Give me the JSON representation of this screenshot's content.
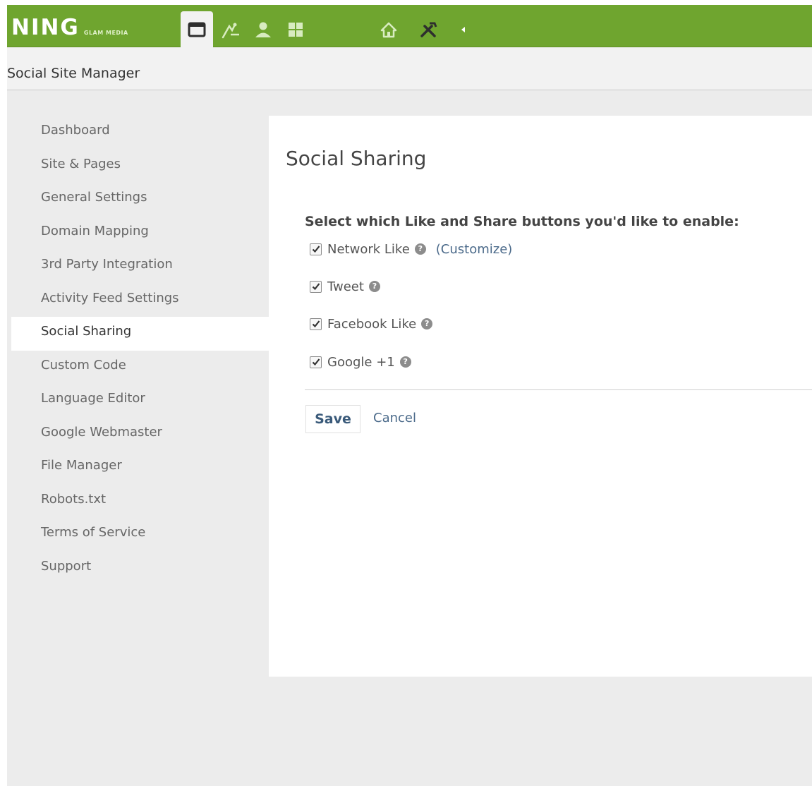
{
  "brand": {
    "logo": "NING",
    "logo_sub": "GLAM MEDIA"
  },
  "colors": {
    "topbar": "#6fa52f",
    "link": "#4b6a8a"
  },
  "topnav": {
    "icons": [
      "window-icon",
      "paint-icon",
      "person-icon",
      "grid-icon",
      "home-icon",
      "tools-icon",
      "caret-left-icon"
    ],
    "active": "window-icon"
  },
  "header": {
    "title": "Social Site Manager"
  },
  "sidebar": {
    "items": [
      {
        "label": "Dashboard"
      },
      {
        "label": "Site & Pages"
      },
      {
        "label": "General Settings"
      },
      {
        "label": "Domain Mapping"
      },
      {
        "label": "3rd Party Integration"
      },
      {
        "label": "Activity Feed Settings"
      },
      {
        "label": "Social Sharing"
      },
      {
        "label": "Custom Code"
      },
      {
        "label": "Language Editor"
      },
      {
        "label": "Google Webmaster"
      },
      {
        "label": "File Manager"
      },
      {
        "label": "Robots.txt"
      },
      {
        "label": "Terms of Service"
      },
      {
        "label": "Support"
      }
    ],
    "active_label": "Social Sharing"
  },
  "content": {
    "title": "Social Sharing",
    "prompt": "Select which Like and Share buttons you'd like to enable:",
    "options": [
      {
        "label": "Network Like",
        "checked": true,
        "extra": "(Customize)"
      },
      {
        "label": "Tweet",
        "checked": true
      },
      {
        "label": "Facebook Like",
        "checked": true
      },
      {
        "label": "Google +1",
        "checked": true
      }
    ],
    "save_label": "Save",
    "cancel_label": "Cancel"
  }
}
